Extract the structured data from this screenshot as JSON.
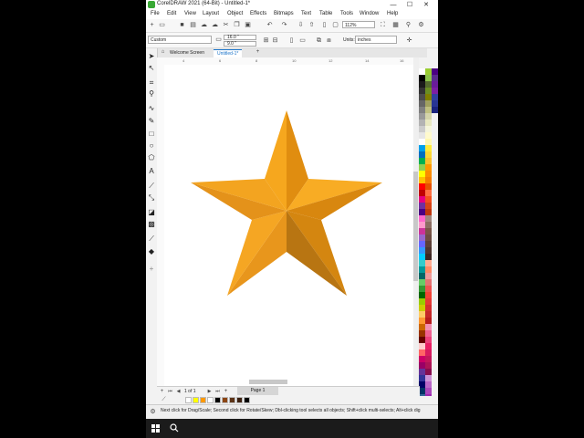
{
  "titlebar": {
    "title": "CorelDRAW 2021 (64-Bit) - Untitled-1*",
    "minimize": "—",
    "maximize": "☐",
    "close": "✕"
  },
  "menu": [
    "File",
    "Edit",
    "View",
    "Layout",
    "Object",
    "Effects",
    "Bitmaps",
    "Text",
    "Table",
    "Tools",
    "Window",
    "Help"
  ],
  "toolbar": {
    "zoom": "112%"
  },
  "property_bar": {
    "preset": "Custom",
    "width": "16.0 \"",
    "height": "9.0 \"",
    "units_label": "Units:",
    "units": "inches"
  },
  "tabs": [
    "Welcome Screen",
    "Untitled-1*"
  ],
  "ruler": {
    "ticks": [
      "4",
      "6",
      "8",
      "10",
      "12",
      "14",
      "16"
    ]
  },
  "navigator": {
    "page_count": "1 of 1",
    "page_tab": "Page 1"
  },
  "status": {
    "hint": "Next click for Drag/Scale; Second click for Rotate/Skew; Dbl-clicking tool selects all objects; Shift+click multi-selects; Alt+click dig"
  },
  "colors": {
    "star_light": "#f5a623",
    "star_mid": "#e8951a",
    "star_dark": "#b87410",
    "accent": "#1a73c9"
  }
}
